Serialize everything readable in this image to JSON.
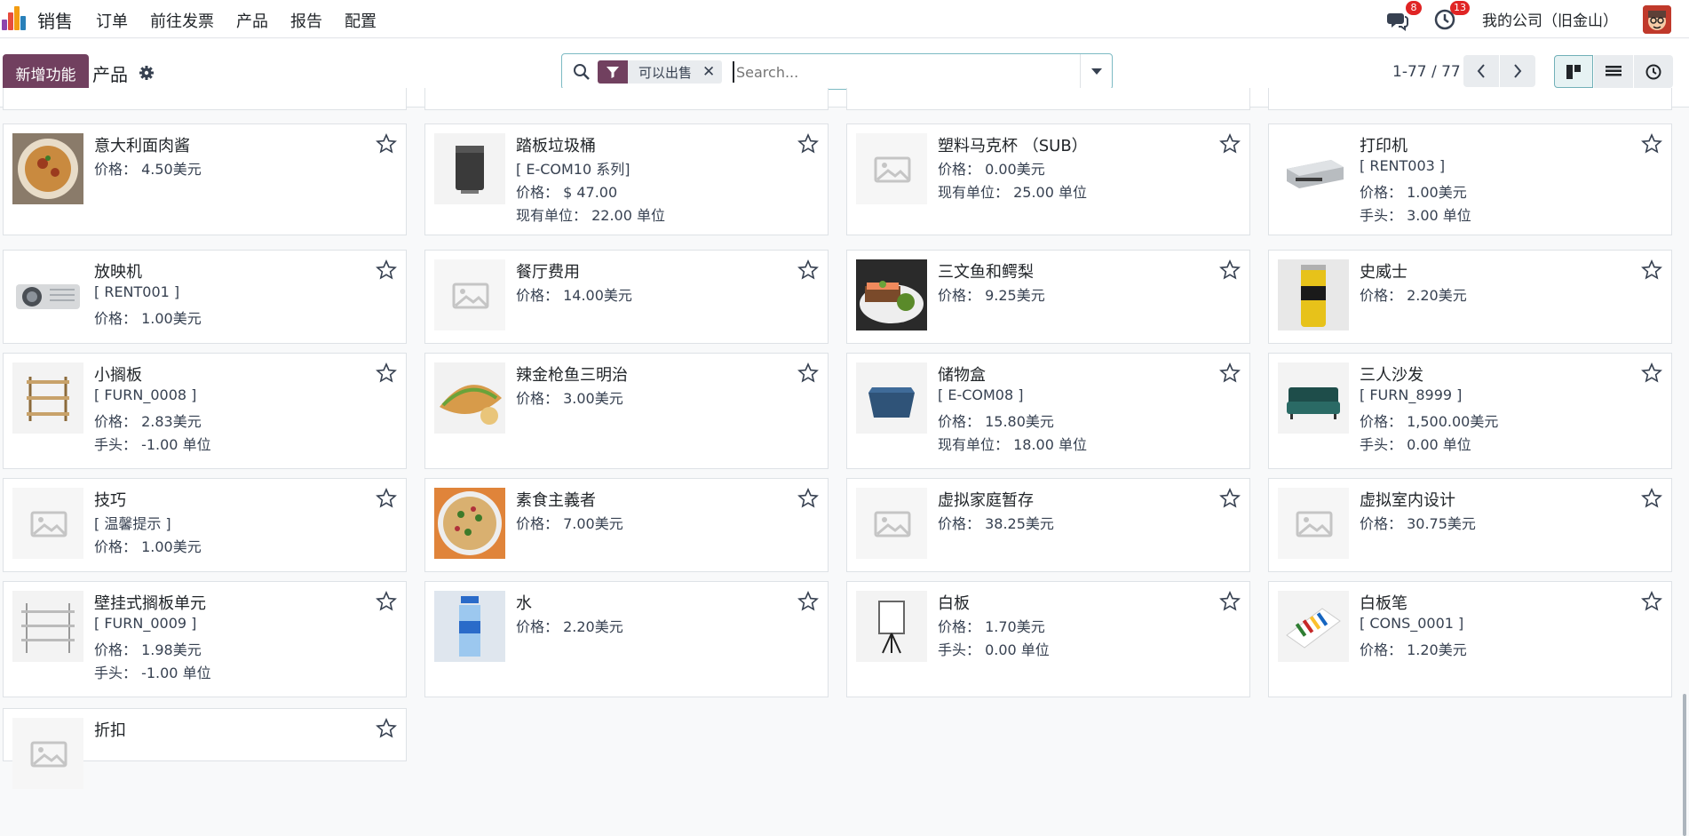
{
  "navbar": {
    "brand": "销售",
    "menu": [
      "订单",
      "前往发票",
      "产品",
      "报告",
      "配置"
    ],
    "messages_count": "8",
    "activities_count": "13",
    "company": "我的公司（旧金山）",
    "logo_colors": [
      "#f39c12",
      "#e74c3c",
      "#8e44ad",
      "#2980b9"
    ]
  },
  "control": {
    "new_label": "新增功能",
    "breadcrumb": "产品",
    "facet_value": "可以出售",
    "search_placeholder": "Search...",
    "pager": "1-77 / 77"
  },
  "cards": [
    {
      "title": "意大利面肉酱",
      "lines": [
        "价格：  4.50美元"
      ],
      "image": "pasta"
    },
    {
      "title": "踏板垃圾桶",
      "lines": [
        "[ E-COM10 系列]",
        "价格：  $ 47.00",
        "现有单位：  22.00 单位"
      ],
      "image": "trash"
    },
    {
      "title": "塑料马克杯  （SUB）",
      "lines": [
        "价格：  0.00美元",
        "现有单位：  25.00 单位"
      ],
      "image": "placeholder"
    },
    {
      "title": "打印机",
      "lines": [
        "[ RENT003 ]",
        "价格：  1.00美元",
        "手头：  3.00 单位"
      ],
      "image": "printer"
    },
    {
      "title": "放映机",
      "lines": [
        "[ RENT001 ]",
        "价格：  1.00美元"
      ],
      "image": "projector"
    },
    {
      "title": "餐厅费用",
      "lines": [
        "价格：  14.00美元"
      ],
      "image": "placeholder"
    },
    {
      "title": "三文鱼和鳄梨",
      "lines": [
        "价格：  9.25美元"
      ],
      "image": "salmon"
    },
    {
      "title": "史威士",
      "lines": [
        "价格：  2.20美元"
      ],
      "image": "can"
    },
    {
      "title": "小搁板",
      "lines": [
        "[ FURN_0008 ]",
        "价格：  2.83美元",
        "手头：  -1.00 单位"
      ],
      "image": "shelf"
    },
    {
      "title": "辣金枪鱼三明治",
      "lines": [
        "价格：  3.00美元"
      ],
      "image": "sandwich"
    },
    {
      "title": "储物盒",
      "lines": [
        "[ E-COM08 ]",
        "价格：  15.80美元",
        "现有单位：  18.00 单位"
      ],
      "image": "box"
    },
    {
      "title": "三人沙发",
      "lines": [
        "[ FURN_8999 ]",
        "价格：  1,500.00美元",
        "手头：  0.00 单位"
      ],
      "image": "sofa"
    },
    {
      "title": "技巧",
      "lines": [
        "[ 温馨提示 ]",
        "价格：  1.00美元"
      ],
      "image": "placeholder"
    },
    {
      "title": "素食主義者",
      "lines": [
        "价格：  7.00美元"
      ],
      "image": "pizza"
    },
    {
      "title": "虚拟家庭暂存",
      "lines": [
        "价格：  38.25美元"
      ],
      "image": "placeholder"
    },
    {
      "title": "虚拟室内设计",
      "lines": [
        "价格：  30.75美元"
      ],
      "image": "placeholder"
    },
    {
      "title": "壁挂式搁板单元",
      "lines": [
        "[ FURN_0009 ]",
        "价格：  1.98美元",
        "手头：  -1.00 单位"
      ],
      "image": "wallshelf"
    },
    {
      "title": "水",
      "lines": [
        "价格：  2.20美元"
      ],
      "image": "water"
    },
    {
      "title": "白板",
      "lines": [
        "价格：  1.70美元",
        "手头：  0.00 单位"
      ],
      "image": "whiteboard"
    },
    {
      "title": "白板笔",
      "lines": [
        "[ CONS_0001 ]",
        "价格：  1.20美元"
      ],
      "image": "pens"
    },
    {
      "title": "折扣",
      "lines": [],
      "image": "placeholder"
    }
  ]
}
